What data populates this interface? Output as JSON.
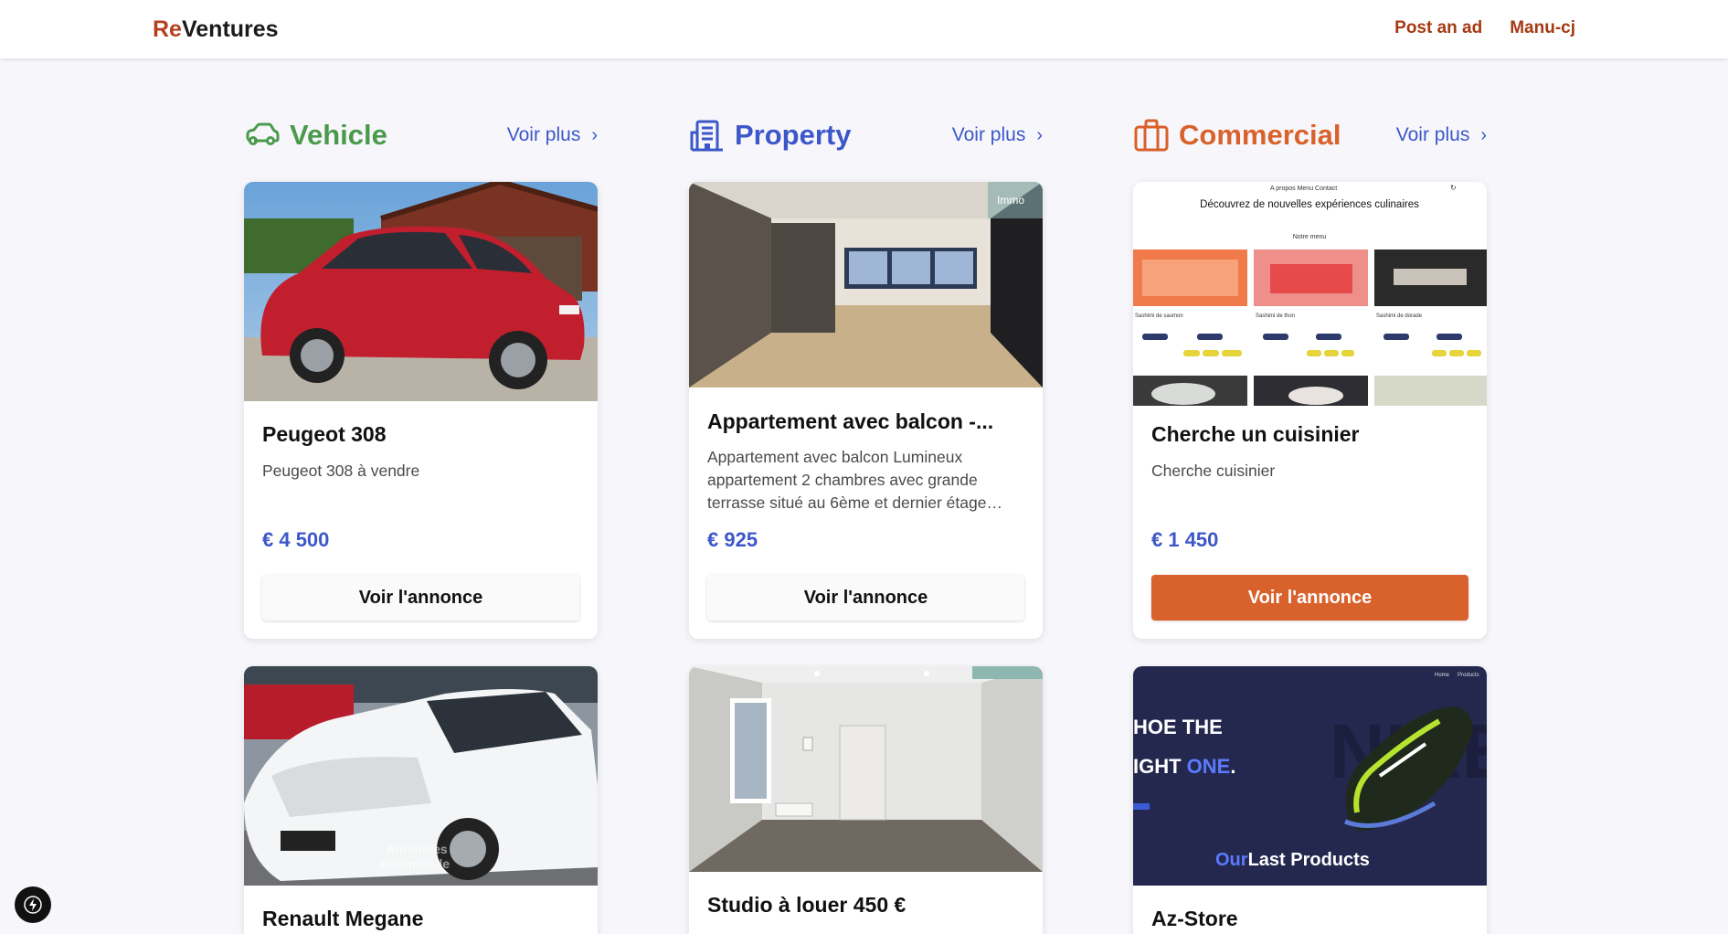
{
  "header": {
    "logo_prefix": "Re",
    "logo_suffix": "Ventures",
    "nav_post": "Post an ad",
    "nav_user": "Manu-cj"
  },
  "colors": {
    "brand": "#b5401d",
    "vehicle": "#4a9a4c",
    "property": "#3d57c9",
    "commercial": "#d9612b",
    "price": "#3d57c9"
  },
  "columns": [
    {
      "title": "Vehicle",
      "icon": "car-icon",
      "voir_plus": "Voir plus",
      "cards": [
        {
          "image": "red-hatchback-car-photo",
          "title": "Peugeot 308",
          "description": "Peugeot 308 à vendre",
          "price": "€ 4 500",
          "button": "Voir l'annonce"
        },
        {
          "image": "white-estate-car-photo",
          "title": "Renault Megane",
          "watermark": "Annonces Automobile"
        }
      ]
    },
    {
      "title": "Property",
      "icon": "building-icon",
      "voir_plus": "Voir plus",
      "cards": [
        {
          "image": "apartment-living-room-photo",
          "title": "Appartement avec balcon -...",
          "description": "Appartement avec balcon Lumineux appartement 2 chambres avec grande terrasse situé au 6ème et dernier étage…",
          "price": "€ 925",
          "button": "Voir l'annonce",
          "watermark": "Immo"
        },
        {
          "image": "empty-studio-room-photo",
          "title": "Studio à louer 450 €"
        }
      ]
    },
    {
      "title": "Commercial",
      "icon": "briefcase-icon",
      "voir_plus": "Voir plus",
      "cards": [
        {
          "image": "restaurant-website-screenshot",
          "title": "Cherche un cuisinier",
          "description": "Cherche cuisinier",
          "price": "€ 1 450",
          "button": "Voir l'annonce",
          "preview": {
            "nav": "A propos  Menu  Contact",
            "heading": "Découvrez de nouvelles expériences culinaires",
            "menu_label": "Notre menu",
            "items": [
              "Sashimi de saumon",
              "Sashimi de thon",
              "Sashimi de dorade"
            ]
          }
        },
        {
          "image": "shoe-store-website-screenshot",
          "title": "Az-Store",
          "preview": {
            "nav": [
              "Home",
              "Products"
            ],
            "headline_1": "HOE THE",
            "headline_2a": "IGHT ",
            "headline_2b": "ONE",
            "headline_2c": ".",
            "brand_bg": "NIKE",
            "footer_a": "Our",
            "footer_b": "Last Products"
          }
        }
      ]
    }
  ]
}
